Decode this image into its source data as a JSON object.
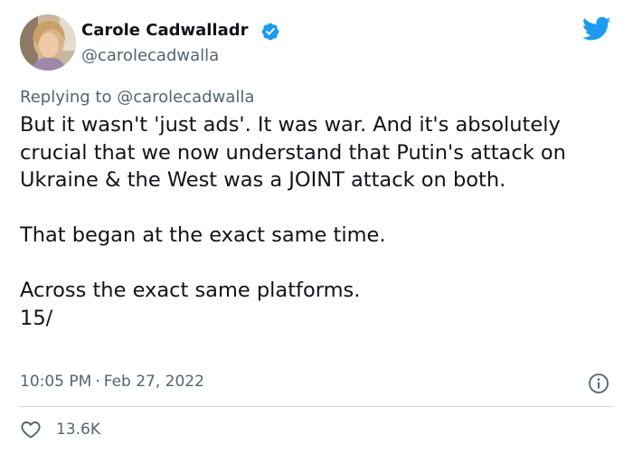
{
  "author": {
    "name": "Carole Cadwalladr",
    "handle": "@carolecadwalla",
    "verified": true
  },
  "reply": {
    "prefix": "Replying to",
    "handle": "@carolecadwalla"
  },
  "tweet": {
    "paragraphs": [
      "But it wasn't 'just ads'. It was war. And it's absolutely crucial that we now understand that Putin's attack on Ukraine & the West was a JOINT attack on both.",
      "That began at the exact same time.",
      "Across the exact same platforms.",
      "15/"
    ]
  },
  "meta": {
    "time": "10:05 PM",
    "separator": "·",
    "date": "Feb 27, 2022"
  },
  "stats": {
    "likes": "13.6K"
  },
  "icons": {
    "verified": "verified-badge-icon",
    "platform": "twitter-bird-icon",
    "info": "info-icon",
    "like": "heart-icon"
  },
  "colors": {
    "brand": "#1d9bf0",
    "text": "#0f1419",
    "secondary": "#536471",
    "divider": "#cfd9de"
  }
}
